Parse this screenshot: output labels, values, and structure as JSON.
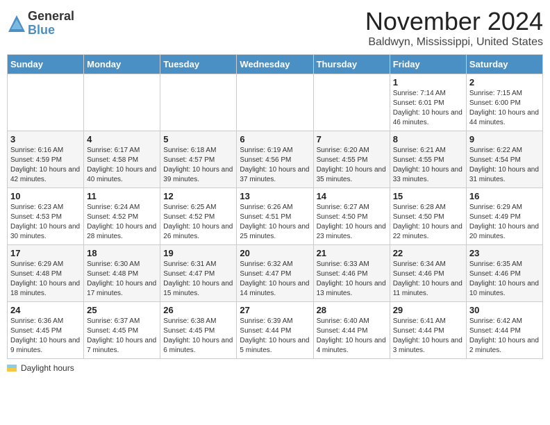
{
  "header": {
    "logo": {
      "general": "General",
      "blue": "Blue"
    },
    "title": "November 2024",
    "subtitle": "Baldwyn, Mississippi, United States"
  },
  "weekdays": [
    "Sunday",
    "Monday",
    "Tuesday",
    "Wednesday",
    "Thursday",
    "Friday",
    "Saturday"
  ],
  "weeks": [
    [
      {
        "day": "",
        "info": ""
      },
      {
        "day": "",
        "info": ""
      },
      {
        "day": "",
        "info": ""
      },
      {
        "day": "",
        "info": ""
      },
      {
        "day": "",
        "info": ""
      },
      {
        "day": "1",
        "info": "Sunrise: 7:14 AM\nSunset: 6:01 PM\nDaylight: 10 hours and 46 minutes."
      },
      {
        "day": "2",
        "info": "Sunrise: 7:15 AM\nSunset: 6:00 PM\nDaylight: 10 hours and 44 minutes."
      }
    ],
    [
      {
        "day": "3",
        "info": "Sunrise: 6:16 AM\nSunset: 4:59 PM\nDaylight: 10 hours and 42 minutes."
      },
      {
        "day": "4",
        "info": "Sunrise: 6:17 AM\nSunset: 4:58 PM\nDaylight: 10 hours and 40 minutes."
      },
      {
        "day": "5",
        "info": "Sunrise: 6:18 AM\nSunset: 4:57 PM\nDaylight: 10 hours and 39 minutes."
      },
      {
        "day": "6",
        "info": "Sunrise: 6:19 AM\nSunset: 4:56 PM\nDaylight: 10 hours and 37 minutes."
      },
      {
        "day": "7",
        "info": "Sunrise: 6:20 AM\nSunset: 4:55 PM\nDaylight: 10 hours and 35 minutes."
      },
      {
        "day": "8",
        "info": "Sunrise: 6:21 AM\nSunset: 4:55 PM\nDaylight: 10 hours and 33 minutes."
      },
      {
        "day": "9",
        "info": "Sunrise: 6:22 AM\nSunset: 4:54 PM\nDaylight: 10 hours and 31 minutes."
      }
    ],
    [
      {
        "day": "10",
        "info": "Sunrise: 6:23 AM\nSunset: 4:53 PM\nDaylight: 10 hours and 30 minutes."
      },
      {
        "day": "11",
        "info": "Sunrise: 6:24 AM\nSunset: 4:52 PM\nDaylight: 10 hours and 28 minutes."
      },
      {
        "day": "12",
        "info": "Sunrise: 6:25 AM\nSunset: 4:52 PM\nDaylight: 10 hours and 26 minutes."
      },
      {
        "day": "13",
        "info": "Sunrise: 6:26 AM\nSunset: 4:51 PM\nDaylight: 10 hours and 25 minutes."
      },
      {
        "day": "14",
        "info": "Sunrise: 6:27 AM\nSunset: 4:50 PM\nDaylight: 10 hours and 23 minutes."
      },
      {
        "day": "15",
        "info": "Sunrise: 6:28 AM\nSunset: 4:50 PM\nDaylight: 10 hours and 22 minutes."
      },
      {
        "day": "16",
        "info": "Sunrise: 6:29 AM\nSunset: 4:49 PM\nDaylight: 10 hours and 20 minutes."
      }
    ],
    [
      {
        "day": "17",
        "info": "Sunrise: 6:29 AM\nSunset: 4:48 PM\nDaylight: 10 hours and 18 minutes."
      },
      {
        "day": "18",
        "info": "Sunrise: 6:30 AM\nSunset: 4:48 PM\nDaylight: 10 hours and 17 minutes."
      },
      {
        "day": "19",
        "info": "Sunrise: 6:31 AM\nSunset: 4:47 PM\nDaylight: 10 hours and 15 minutes."
      },
      {
        "day": "20",
        "info": "Sunrise: 6:32 AM\nSunset: 4:47 PM\nDaylight: 10 hours and 14 minutes."
      },
      {
        "day": "21",
        "info": "Sunrise: 6:33 AM\nSunset: 4:46 PM\nDaylight: 10 hours and 13 minutes."
      },
      {
        "day": "22",
        "info": "Sunrise: 6:34 AM\nSunset: 4:46 PM\nDaylight: 10 hours and 11 minutes."
      },
      {
        "day": "23",
        "info": "Sunrise: 6:35 AM\nSunset: 4:46 PM\nDaylight: 10 hours and 10 minutes."
      }
    ],
    [
      {
        "day": "24",
        "info": "Sunrise: 6:36 AM\nSunset: 4:45 PM\nDaylight: 10 hours and 9 minutes."
      },
      {
        "day": "25",
        "info": "Sunrise: 6:37 AM\nSunset: 4:45 PM\nDaylight: 10 hours and 7 minutes."
      },
      {
        "day": "26",
        "info": "Sunrise: 6:38 AM\nSunset: 4:45 PM\nDaylight: 10 hours and 6 minutes."
      },
      {
        "day": "27",
        "info": "Sunrise: 6:39 AM\nSunset: 4:44 PM\nDaylight: 10 hours and 5 minutes."
      },
      {
        "day": "28",
        "info": "Sunrise: 6:40 AM\nSunset: 4:44 PM\nDaylight: 10 hours and 4 minutes."
      },
      {
        "day": "29",
        "info": "Sunrise: 6:41 AM\nSunset: 4:44 PM\nDaylight: 10 hours and 3 minutes."
      },
      {
        "day": "30",
        "info": "Sunrise: 6:42 AM\nSunset: 4:44 PM\nDaylight: 10 hours and 2 minutes."
      }
    ]
  ],
  "footer": {
    "label": "Daylight hours"
  }
}
